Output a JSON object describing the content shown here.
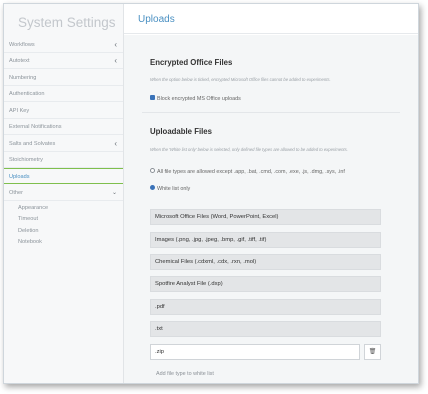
{
  "sidebar": {
    "title": "System Settings",
    "items": [
      {
        "label": "Workflows",
        "chevron": "chevron-left-icon"
      },
      {
        "label": "Autotext",
        "chevron": "chevron-left-icon"
      },
      {
        "label": "Numbering"
      },
      {
        "label": "Authentication"
      },
      {
        "label": "API Key"
      },
      {
        "label": "External Notifications"
      },
      {
        "label": "Salts and Solvates",
        "chevron": "chevron-left-icon"
      },
      {
        "label": "Stoichiometry"
      },
      {
        "label": "Uploads"
      },
      {
        "label": "Other",
        "chevron": "chevron-down-icon"
      }
    ],
    "subitems": [
      "Appearance",
      "Timeout",
      "Deletion",
      "Notebook"
    ]
  },
  "header": {
    "title": "Uploads"
  },
  "encrypted": {
    "title": "Encrypted Office Files",
    "note": "When the option below is ticked, encrypted Microsoft Office files cannot be added to experiments.",
    "checkbox_label": "Block encrypted MS Office uploads"
  },
  "uploadable": {
    "title": "Uploadable Files",
    "note": "When the 'White list only' below is selected, only defined file types are allowed to be added to experiments.",
    "option_all": "All file types are allowed except .app, .bat, .cmd, .com, .exe, .js, .dmg, .sys, .inf",
    "option_white": "White list only",
    "file_types": [
      "Microsoft Office Files (Word, PowerPoint, Excel)",
      "Images (.png, .jpg, .jpeg, .bmp, .gif, .tiff, .tif)",
      "Chemical Files (.cdxml, .cdx, .rxn, .mol)",
      "Spotfire Analyst File (.dxp)",
      ".pdf",
      ".txt"
    ],
    "input_value": ".zip",
    "add_label": "Add file type to white list"
  },
  "colors": {
    "accent": "#4a90c2",
    "active_border": "#7fbf4d",
    "check": "#3a72b8"
  }
}
